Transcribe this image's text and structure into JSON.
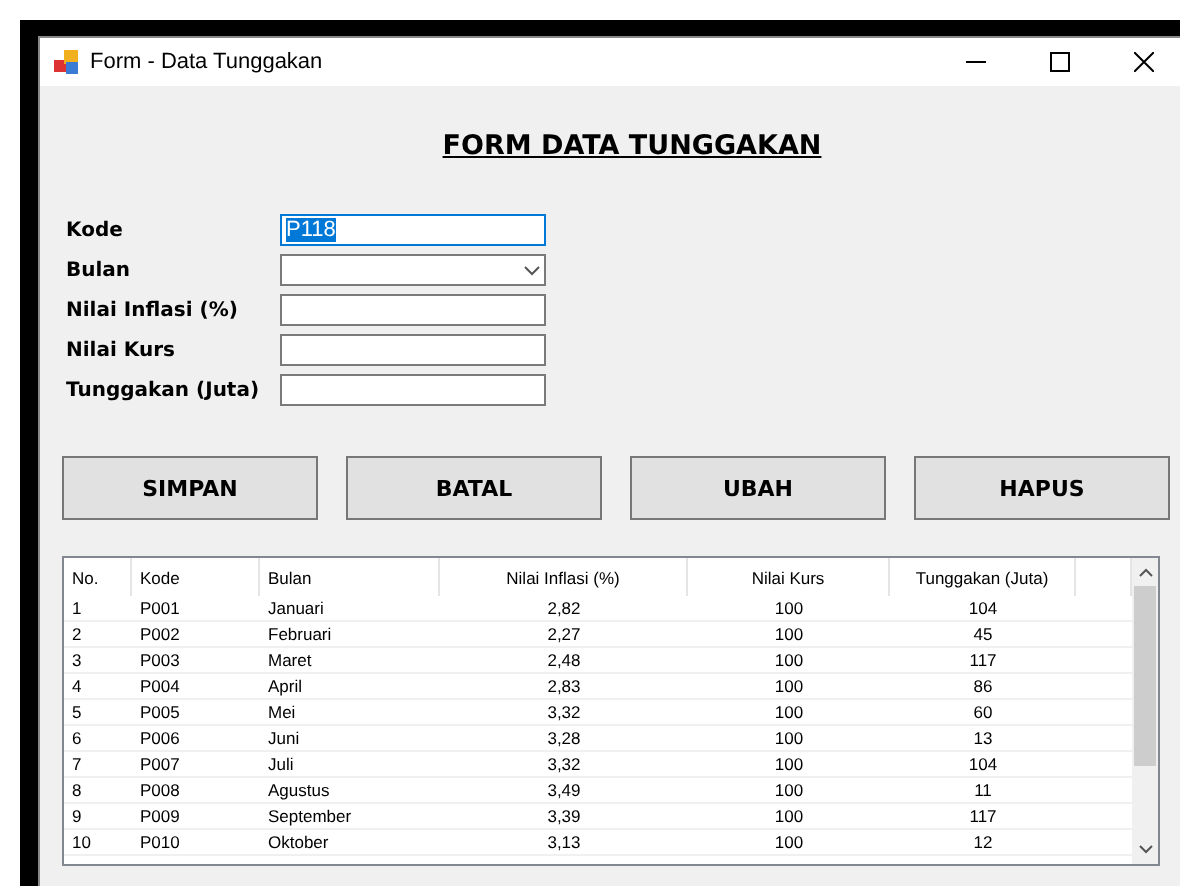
{
  "window": {
    "title": "Form - Data Tunggakan"
  },
  "heading": "FORM DATA TUNGGAKAN",
  "fields": [
    {
      "kind": "text",
      "label": "Kode",
      "value": "P118",
      "selected": true
    },
    {
      "kind": "dropdown",
      "label": "Bulan"
    },
    {
      "kind": "text",
      "label": "Nilai Inflasi (%)"
    },
    {
      "kind": "text",
      "label": "Nilai Kurs"
    },
    {
      "kind": "text",
      "label": "Tunggakan (Juta)"
    }
  ],
  "buttons": [
    "SIMPAN",
    "BATAL",
    "UBAH",
    "HAPUS"
  ],
  "table": {
    "columns": [
      "No.",
      "Kode",
      "Bulan",
      "Nilai Inflasi (%)",
      "Nilai Kurs",
      "Tunggakan (Juta)"
    ],
    "rows": [
      [
        "1",
        "P001",
        "Januari",
        "2,82",
        "100",
        "104"
      ],
      [
        "2",
        "P002",
        "Februari",
        "2,27",
        "100",
        "45"
      ],
      [
        "3",
        "P003",
        "Maret",
        "2,48",
        "100",
        "117"
      ],
      [
        "4",
        "P004",
        "April",
        "2,83",
        "100",
        "86"
      ],
      [
        "5",
        "P005",
        "Mei",
        "3,32",
        "100",
        "60"
      ],
      [
        "6",
        "P006",
        "Juni",
        "3,28",
        "100",
        "13"
      ],
      [
        "7",
        "P007",
        "Juli",
        "3,32",
        "100",
        "104"
      ],
      [
        "8",
        "P008",
        "Agustus",
        "3,49",
        "100",
        "11"
      ],
      [
        "9",
        "P009",
        "September",
        "3,39",
        "100",
        "117"
      ],
      [
        "10",
        "P010",
        "Oktober",
        "3,13",
        "100",
        "12"
      ]
    ]
  }
}
